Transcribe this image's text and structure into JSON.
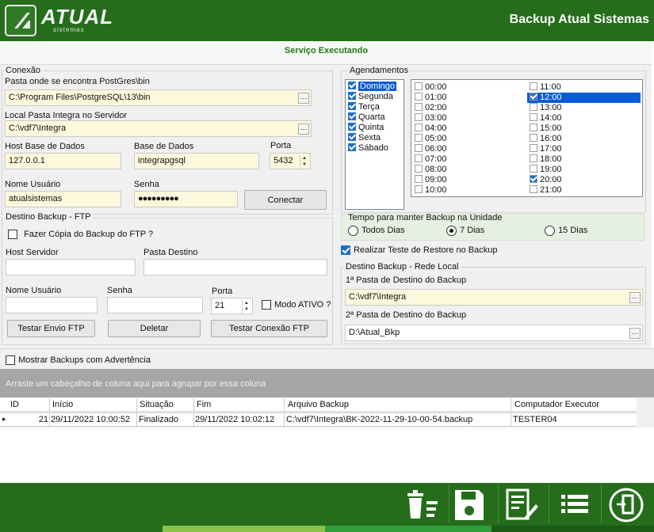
{
  "header": {
    "logo_text": "ATUAL",
    "logo_sub": "sistemas",
    "title": "Backup Atual Sistemas"
  },
  "service_status": "Serviço Executando",
  "conexao": {
    "title": "Conexão",
    "pg_bin_label": "Pasta onde se encontra PostGres\\bin",
    "pg_bin_value": "C:\\Program Files\\PostgreSQL\\13\\bin",
    "integra_label": "Local Pasta Integra no Servidor",
    "integra_value": "C:\\vdf7\\Integra",
    "host_label": "Host Base de Dados",
    "host_value": "127.0.0.1",
    "db_label": "Base de Dados",
    "db_value": "integrapgsql",
    "port_label": "Porta",
    "port_value": "5432",
    "user_label": "Nome Usuário",
    "user_value": "atualsistemas",
    "pass_label": "Senha",
    "pass_value": "●●●●●●●●●",
    "connect_button": "Conectar",
    "ellipsis": "…"
  },
  "ftp": {
    "title": "Destino Backup - FTP",
    "copy_label": "Fazer Cópia do Backup do FTP ?",
    "host_label": "Host Servidor",
    "dest_label": "Pasta Destino",
    "user_label": "Nome Usuário",
    "pass_label": "Senha",
    "port_label": "Porta",
    "port_value": "21",
    "active_label": "Modo ATIVO ?",
    "test_send_button": "Testar Envio FTP",
    "delete_button": "Deletar",
    "test_conn_button": "Testar Conexão FTP"
  },
  "agendamentos": {
    "title": "Agendamentos",
    "days": [
      {
        "label": "Domingo",
        "checked": true,
        "selected": true
      },
      {
        "label": "Segunda",
        "checked": true
      },
      {
        "label": "Terça",
        "checked": true
      },
      {
        "label": "Quarta",
        "checked": true
      },
      {
        "label": "Quinta",
        "checked": true
      },
      {
        "label": "Sexta",
        "checked": true
      },
      {
        "label": "Sábado",
        "checked": true
      }
    ],
    "hours_left": [
      {
        "label": "00:00",
        "checked": false
      },
      {
        "label": "01:00",
        "checked": false
      },
      {
        "label": "02:00",
        "checked": false
      },
      {
        "label": "03:00",
        "checked": false
      },
      {
        "label": "04:00",
        "checked": false
      },
      {
        "label": "05:00",
        "checked": false
      },
      {
        "label": "06:00",
        "checked": false
      },
      {
        "label": "07:00",
        "checked": false
      },
      {
        "label": "08:00",
        "checked": false
      },
      {
        "label": "09:00",
        "checked": false
      },
      {
        "label": "10:00",
        "checked": false
      }
    ],
    "hours_right": [
      {
        "label": "11:00",
        "checked": false
      },
      {
        "label": "12:00",
        "checked": true,
        "selected": true
      },
      {
        "label": "13:00",
        "checked": false
      },
      {
        "label": "14:00",
        "checked": false
      },
      {
        "label": "15:00",
        "checked": false
      },
      {
        "label": "16:00",
        "checked": false
      },
      {
        "label": "17:00",
        "checked": false
      },
      {
        "label": "18:00",
        "checked": false
      },
      {
        "label": "19:00",
        "checked": false
      },
      {
        "label": "20:00",
        "checked": true
      },
      {
        "label": "21:00",
        "checked": false
      }
    ]
  },
  "retention": {
    "title": "Tempo para manter Backup na Unidade",
    "options": [
      "Todos Dias",
      "7 Dias",
      "15 Dias"
    ],
    "selected": "7 Dias"
  },
  "restore_test_label": "Realizar Teste de Restore no Backup",
  "rede": {
    "title": "Destino Backup - Rede Local",
    "dest1_label": "1ª Pasta de Destino do Backup",
    "dest1_value": "C:\\vdf7\\Integra",
    "dest2_label": "2ª Pasta de Destino do Backup",
    "dest2_value": "D:\\Atual_Bkp"
  },
  "show_warnings_label": "Mostrar Backups com Advertência",
  "grid": {
    "group_hint": "Arraste um cabeçalho de coluna aqui para agrupar por essa coluna",
    "columns": [
      "ID",
      "Início",
      "Situação",
      "Fim",
      "Arquivo Backup",
      "Computador Executor"
    ],
    "row": [
      "21",
      "29/11/2022 10:00:52",
      "Finalizado",
      "29/11/2022 10:02:12",
      "C:\\vdf7\\Integra\\BK-2022-11-29-10-00-54.backup",
      "TESTER04"
    ],
    "row_indicator": "▸"
  },
  "colors": {
    "header_green": "#256d1b",
    "status_green": "#1f7a14",
    "field_yellow": "#fbf8dc",
    "selection_blue": "#0a5bd6",
    "group_area_gray": "#a6a6a6"
  },
  "footer_icons": [
    "delete-list-icon",
    "save-icon",
    "edit-document-icon",
    "list-icon",
    "exit-icon"
  ]
}
